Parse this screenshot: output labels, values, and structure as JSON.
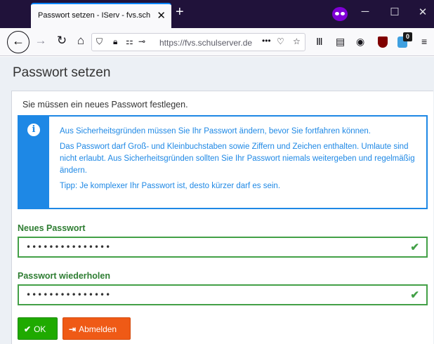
{
  "browser": {
    "tab_title": "Passwort setzen - IServ - fvs.schulserver",
    "tab_close": "✕",
    "new_tab": "+",
    "url": "https://fvs.schulserver.de",
    "addon_badge_count": "0",
    "icons": [
      "back-icon",
      "forward-icon",
      "reload-icon",
      "home-icon",
      "shield-icon",
      "lock-icon",
      "permissions-icon",
      "key-icon",
      "more-icon",
      "pocket-icon",
      "bookmark-star-icon",
      "library-icon",
      "sidebar-icon",
      "account-icon",
      "ublock-icon",
      "extension-icon",
      "menu-icon"
    ]
  },
  "page": {
    "title": "Passwort setzen",
    "lead": "Sie müssen ein neues Passwort festlegen.",
    "info": {
      "lines": [
        "Aus Sicherheitsgründen müssen Sie Ihr Passwort ändern, bevor Sie fortfahren können.",
        "Das Passwort darf Groß- und Kleinbuchstaben sowie Ziffern und Zeichen enthalten. Umlaute sind nicht erlaubt. Aus Sicherheitsgründen sollten Sie Ihr Passwort niemals weitergeben und regelmäßig ändern.",
        "Tipp: Je komplexer Ihr Passwort ist, desto kürzer darf es sein."
      ]
    },
    "new_password_label": "Neues Passwort",
    "new_password_value": "•••••••••••••••",
    "repeat_password_label": "Passwort wiederholen",
    "repeat_password_value": "•••••••••••••••",
    "ok_label": "OK",
    "logout_label": "Abmelden"
  },
  "colors": {
    "info": "#1e88e5",
    "success": "#43a047",
    "ok_button": "#1faa00",
    "logout_button": "#ef5a16",
    "tabbar": "#20123a"
  }
}
